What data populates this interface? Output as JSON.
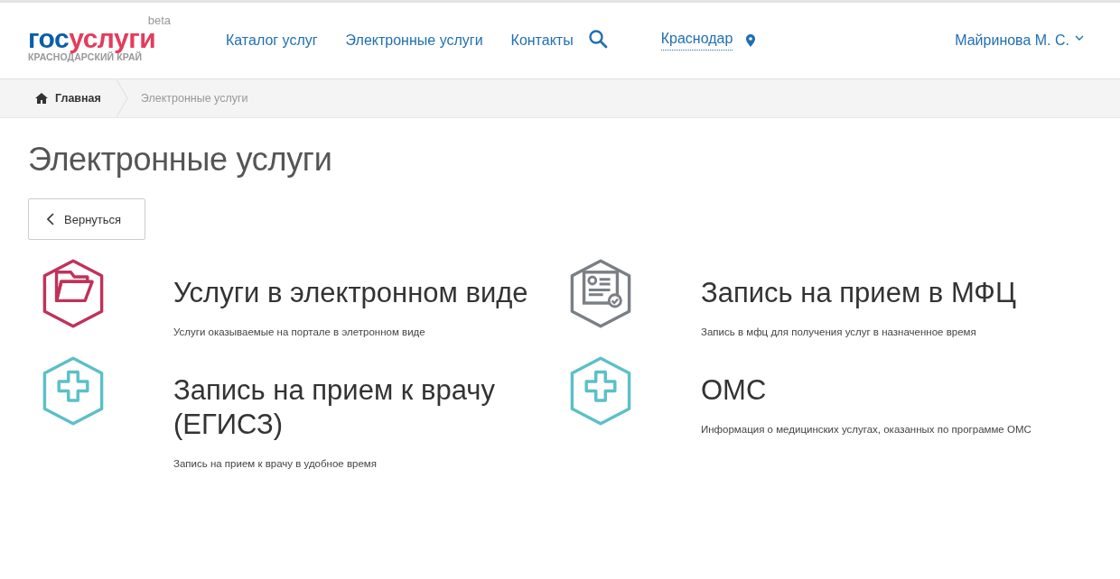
{
  "header": {
    "logo": {
      "part1": "гос",
      "part2": "услуги",
      "badge": "beta",
      "region": "КРАСНОДАРСКИЙ КРАЙ"
    },
    "nav": [
      "Каталог услуг",
      "Электронные услуги",
      "Контакты"
    ],
    "city": "Краснодар",
    "user": "Майринова М. С."
  },
  "breadcrumbs": [
    {
      "label": "Главная",
      "current": false
    },
    {
      "label": "Электронные услуги",
      "current": true
    }
  ],
  "page_title": "Электронные услуги",
  "back_button": "Вернуться",
  "services": [
    {
      "kind": "folder",
      "color": "#c0325a",
      "title": "Услуги в электронном виде",
      "description": "Услуги оказываемые на портале в элетронном виде"
    },
    {
      "kind": "document",
      "color": "#7a7f86",
      "title": "Запись на прием в МФЦ",
      "description": "Запись в мфц для получения услуг в назначенное время"
    },
    {
      "kind": "medical",
      "color": "#5bc0c8",
      "title": "Запись на прием к врачу (ЕГИСЗ)",
      "description": "Запись на прием к врачу в удобное время"
    },
    {
      "kind": "medical",
      "color": "#5bc0c8",
      "title": "ОМС",
      "description": "Информация о медицинских услугах, оказанных по программе ОМС"
    }
  ]
}
